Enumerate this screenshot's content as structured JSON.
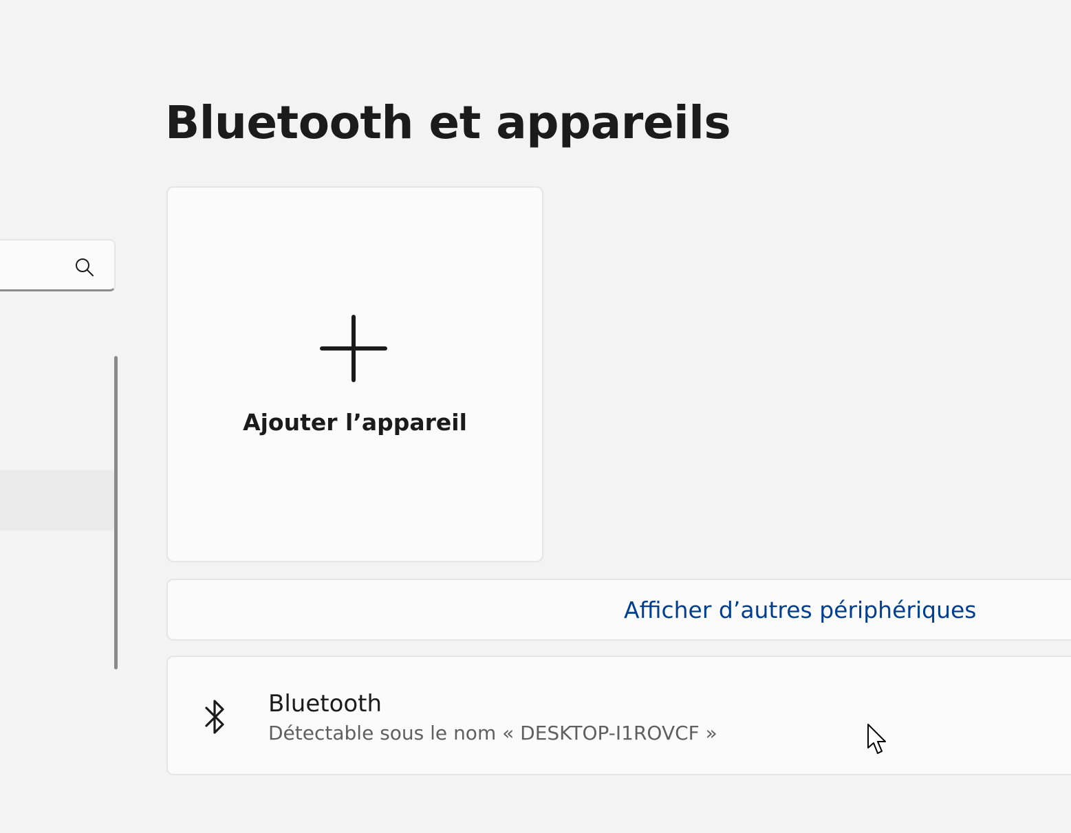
{
  "header": {
    "title": "Bluetooth et appareils"
  },
  "nav": {
    "search_icon": "search-icon"
  },
  "main": {
    "add_device": {
      "label": "Ajouter l’appareil",
      "icon": "plus-icon"
    },
    "more_devices": {
      "link_label": "Afficher d’autres périphériques"
    },
    "bluetooth": {
      "icon": "bluetooth-icon",
      "title": "Bluetooth",
      "subtitle": "Détectable sous le nom « DESKTOP-I1ROVCF »"
    }
  },
  "colors": {
    "background": "#f3f3f3",
    "card": "#fbfbfb",
    "link": "#003e92",
    "text": "#1b1b1b",
    "secondary_text": "#5f5f5f"
  }
}
